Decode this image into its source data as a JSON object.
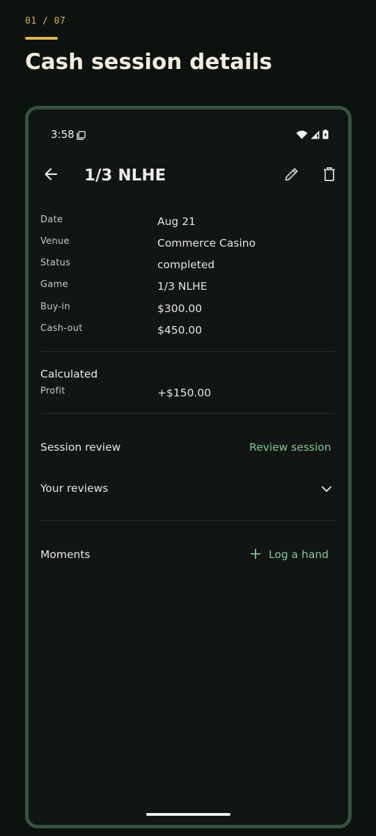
{
  "header": {
    "step": "01 / 07",
    "title": "Cash session details"
  },
  "status_bar": {
    "time": "3:58",
    "icons": [
      "sim-card-icon",
      "wifi-icon",
      "signal-icon",
      "battery-charging-icon"
    ]
  },
  "app_bar": {
    "title": "1/3 NLHE",
    "back_icon": "arrow-back-icon",
    "edit_icon": "pencil-icon",
    "delete_icon": "trash-icon"
  },
  "details": [
    {
      "label": "Date",
      "value": "Aug 21"
    },
    {
      "label": "Venue",
      "value": "Commerce Casino"
    },
    {
      "label": "Status",
      "value": "completed"
    },
    {
      "label": "Game",
      "value": "1/3 NLHE"
    },
    {
      "label": "Buy-in",
      "value": "$300.00"
    },
    {
      "label": "Cash-out",
      "value": "$450.00"
    }
  ],
  "calculated": {
    "heading": "Calculated",
    "profit_label": "Profit",
    "profit_value": "+$150.00"
  },
  "session_review": {
    "label": "Session review",
    "action": "Review session"
  },
  "your_reviews": {
    "label": "Your reviews",
    "expand_icon": "chevron-down-icon"
  },
  "moments": {
    "label": "Moments",
    "action": "Log a hand",
    "action_icon": "plus-icon"
  },
  "colors": {
    "accent_gold": "#e8b547",
    "link_green": "#82c79a",
    "frame_green": "#345440"
  }
}
